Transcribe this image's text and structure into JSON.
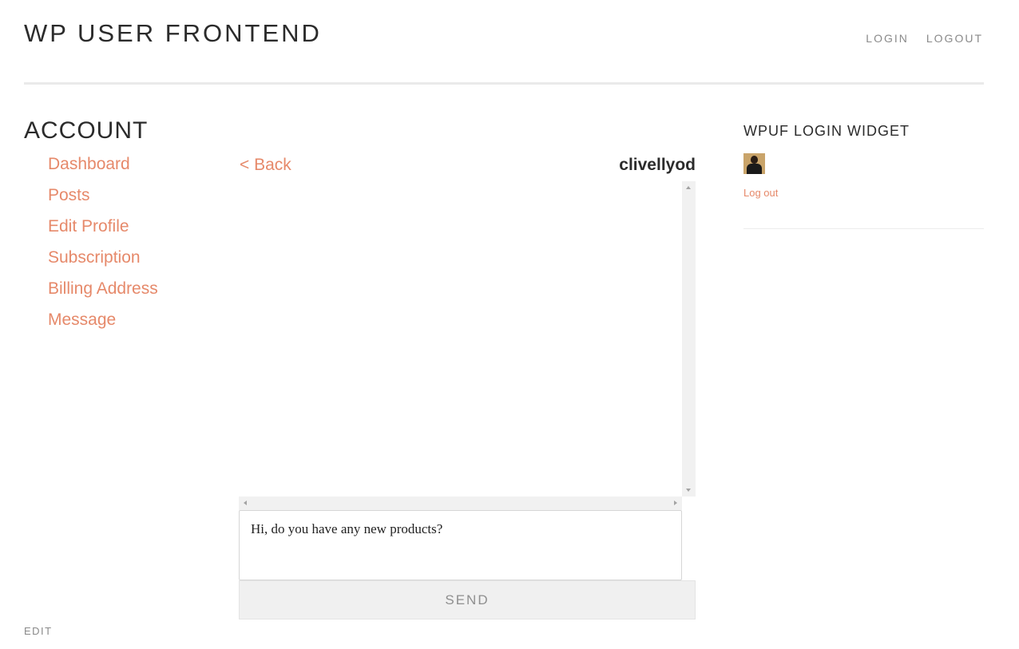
{
  "header": {
    "site_title": "WP USER FRONTEND",
    "nav": [
      {
        "label": "LOGIN"
      },
      {
        "label": "LOGOUT"
      }
    ]
  },
  "account": {
    "title": "ACCOUNT",
    "nav": [
      {
        "label": "Dashboard"
      },
      {
        "label": "Posts"
      },
      {
        "label": "Edit Profile"
      },
      {
        "label": "Subscription"
      },
      {
        "label": "Billing Address"
      },
      {
        "label": "Message"
      }
    ]
  },
  "messaging": {
    "back_label": "< Back",
    "recipient": "clivellyod",
    "draft_message": "Hi, do you have any new products?",
    "send_label": "SEND"
  },
  "sidebar": {
    "widget_title": "WPUF LOGIN WIDGET",
    "logout_label": "Log out"
  },
  "footer": {
    "edit_label": "EDIT"
  },
  "colors": {
    "link_accent": "#e6896a",
    "heading": "#2b2b2b",
    "muted_nav": "#8a8a8a"
  }
}
